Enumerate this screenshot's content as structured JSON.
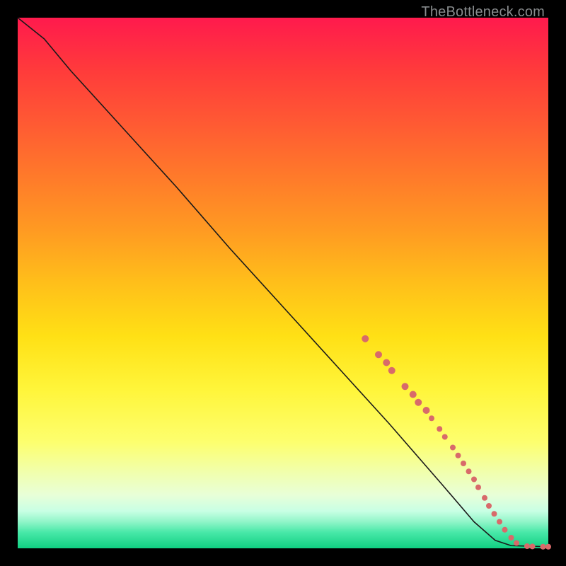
{
  "watermark": "TheBottleneck.com",
  "colors": {
    "marker": "#d86a6a",
    "curve": "#1a1a1a",
    "background": "#000000"
  },
  "chart_data": {
    "type": "line",
    "title": "",
    "xlabel": "",
    "ylabel": "",
    "xlim": [
      0,
      100
    ],
    "ylim": [
      0,
      100
    ],
    "grid": false,
    "legend": false,
    "curve": [
      {
        "x": 0,
        "y": 100
      },
      {
        "x": 5,
        "y": 96
      },
      {
        "x": 10,
        "y": 90
      },
      {
        "x": 20,
        "y": 79
      },
      {
        "x": 30,
        "y": 68
      },
      {
        "x": 40,
        "y": 56.5
      },
      {
        "x": 50,
        "y": 45.5
      },
      {
        "x": 60,
        "y": 34.5
      },
      {
        "x": 70,
        "y": 23.5
      },
      {
        "x": 80,
        "y": 12
      },
      {
        "x": 86,
        "y": 5
      },
      {
        "x": 90,
        "y": 1.5
      },
      {
        "x": 93,
        "y": 0.5
      },
      {
        "x": 100,
        "y": 0.3
      }
    ],
    "markers": [
      {
        "x": 65.5,
        "y": 39.5,
        "r": 5
      },
      {
        "x": 68.0,
        "y": 36.5,
        "r": 5
      },
      {
        "x": 69.5,
        "y": 35.0,
        "r": 5
      },
      {
        "x": 70.5,
        "y": 33.5,
        "r": 5
      },
      {
        "x": 73.0,
        "y": 30.5,
        "r": 5
      },
      {
        "x": 74.5,
        "y": 29.0,
        "r": 5
      },
      {
        "x": 75.5,
        "y": 27.5,
        "r": 5
      },
      {
        "x": 77.0,
        "y": 26.0,
        "r": 5
      },
      {
        "x": 78.0,
        "y": 24.5,
        "r": 4
      },
      {
        "x": 79.5,
        "y": 22.5,
        "r": 4
      },
      {
        "x": 80.5,
        "y": 21.0,
        "r": 4
      },
      {
        "x": 82.0,
        "y": 19.0,
        "r": 4
      },
      {
        "x": 83.0,
        "y": 17.5,
        "r": 4
      },
      {
        "x": 84.0,
        "y": 16.0,
        "r": 4
      },
      {
        "x": 85.0,
        "y": 14.5,
        "r": 4
      },
      {
        "x": 86.0,
        "y": 13.0,
        "r": 4
      },
      {
        "x": 86.8,
        "y": 11.5,
        "r": 4
      },
      {
        "x": 88.0,
        "y": 9.5,
        "r": 4
      },
      {
        "x": 88.8,
        "y": 8.0,
        "r": 4
      },
      {
        "x": 89.8,
        "y": 6.5,
        "r": 4
      },
      {
        "x": 90.8,
        "y": 5.0,
        "r": 4
      },
      {
        "x": 91.8,
        "y": 3.5,
        "r": 4
      },
      {
        "x": 93.0,
        "y": 2.0,
        "r": 4
      },
      {
        "x": 94.0,
        "y": 1.0,
        "r": 4
      },
      {
        "x": 96.0,
        "y": 0.4,
        "r": 4
      },
      {
        "x": 97.0,
        "y": 0.35,
        "r": 4
      },
      {
        "x": 99.0,
        "y": 0.3,
        "r": 4
      },
      {
        "x": 100.0,
        "y": 0.3,
        "r": 4
      }
    ]
  }
}
